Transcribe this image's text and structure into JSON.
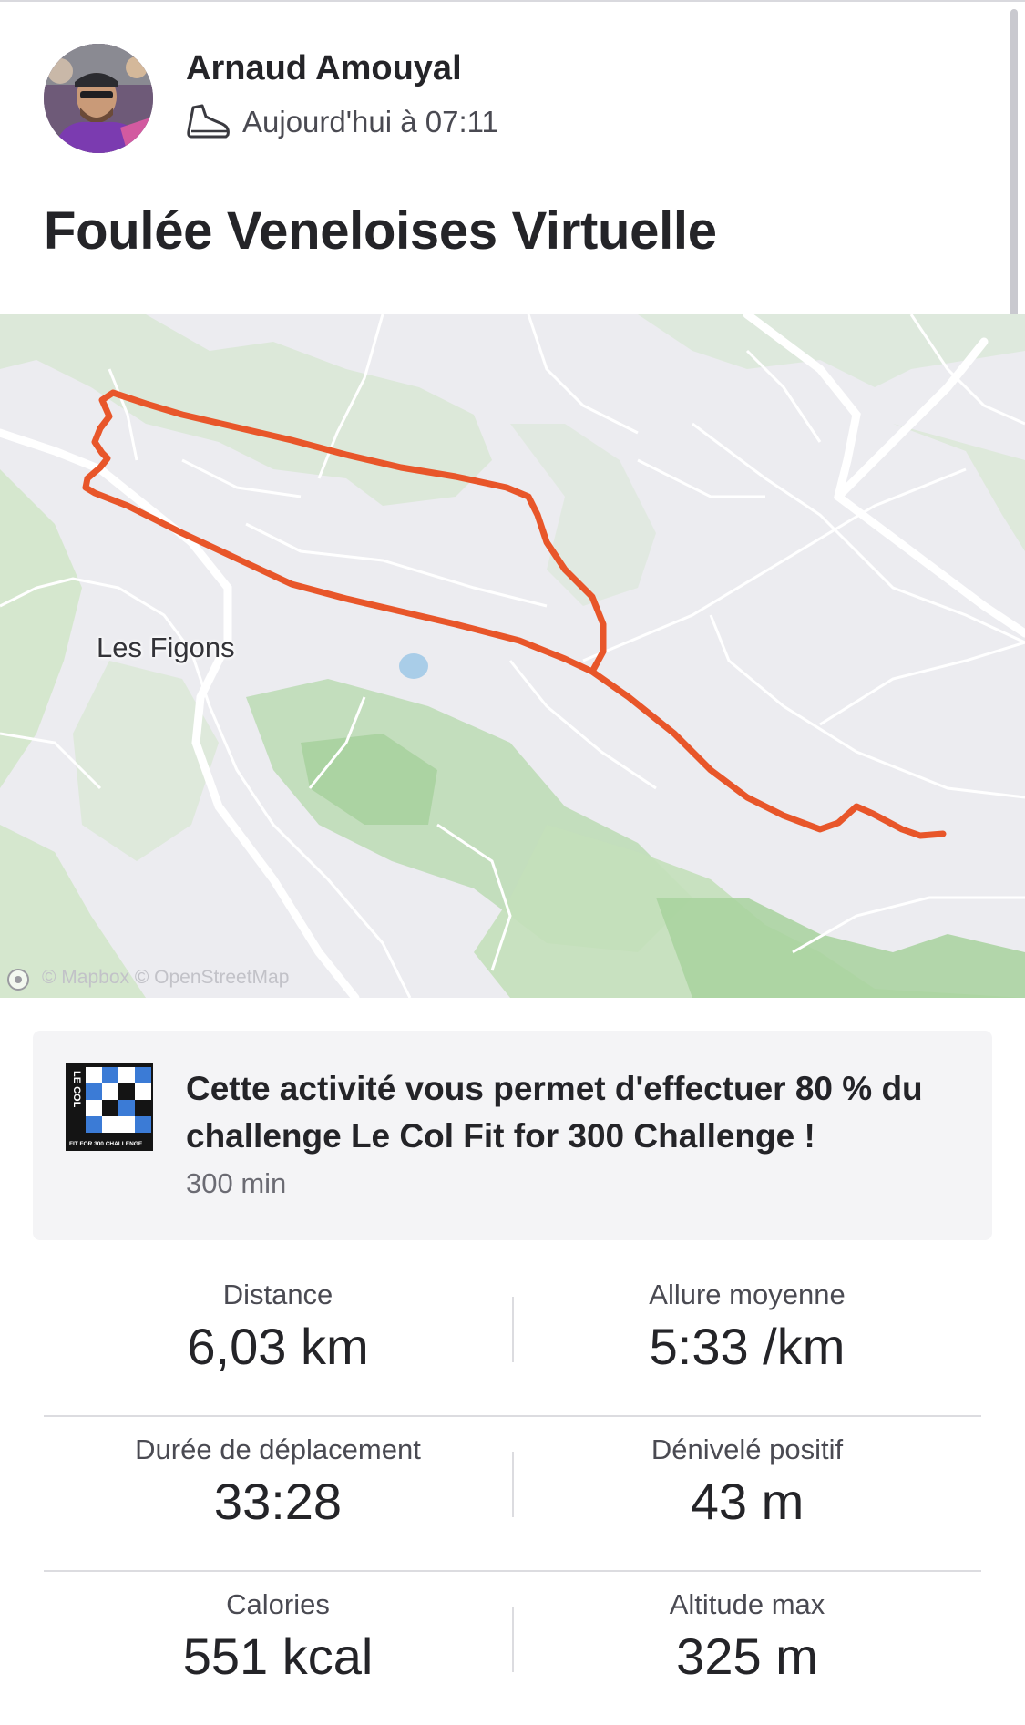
{
  "athlete": {
    "name": "Arnaud Amouyal",
    "activity_icon": "running-shoe-icon",
    "timestamp": "Aujourd'hui à 07:11"
  },
  "activity": {
    "title": "Foulée Veneloises Virtuelle"
  },
  "map": {
    "place_label": "Les Figons",
    "attribution": "© Mapbox © OpenStreetMap",
    "route_color": "#e8562a"
  },
  "challenge": {
    "logo_text": "LE COL",
    "logo_subtext": "FIT FOR 300 CHALLENGE",
    "text": "Cette activité vous permet d'effectuer 80 % du challenge Le Col Fit for 300 Challenge !",
    "subtext": "300 min"
  },
  "stats": [
    {
      "label": "Distance",
      "value": "6,03 km"
    },
    {
      "label": "Allure moyenne",
      "value": "5:33 /km"
    },
    {
      "label": "Durée de déplacement",
      "value": "33:28"
    },
    {
      "label": "Dénivelé positif",
      "value": "43 m"
    },
    {
      "label": "Calories",
      "value": "551 kcal"
    },
    {
      "label": "Altitude max",
      "value": "325 m"
    }
  ]
}
